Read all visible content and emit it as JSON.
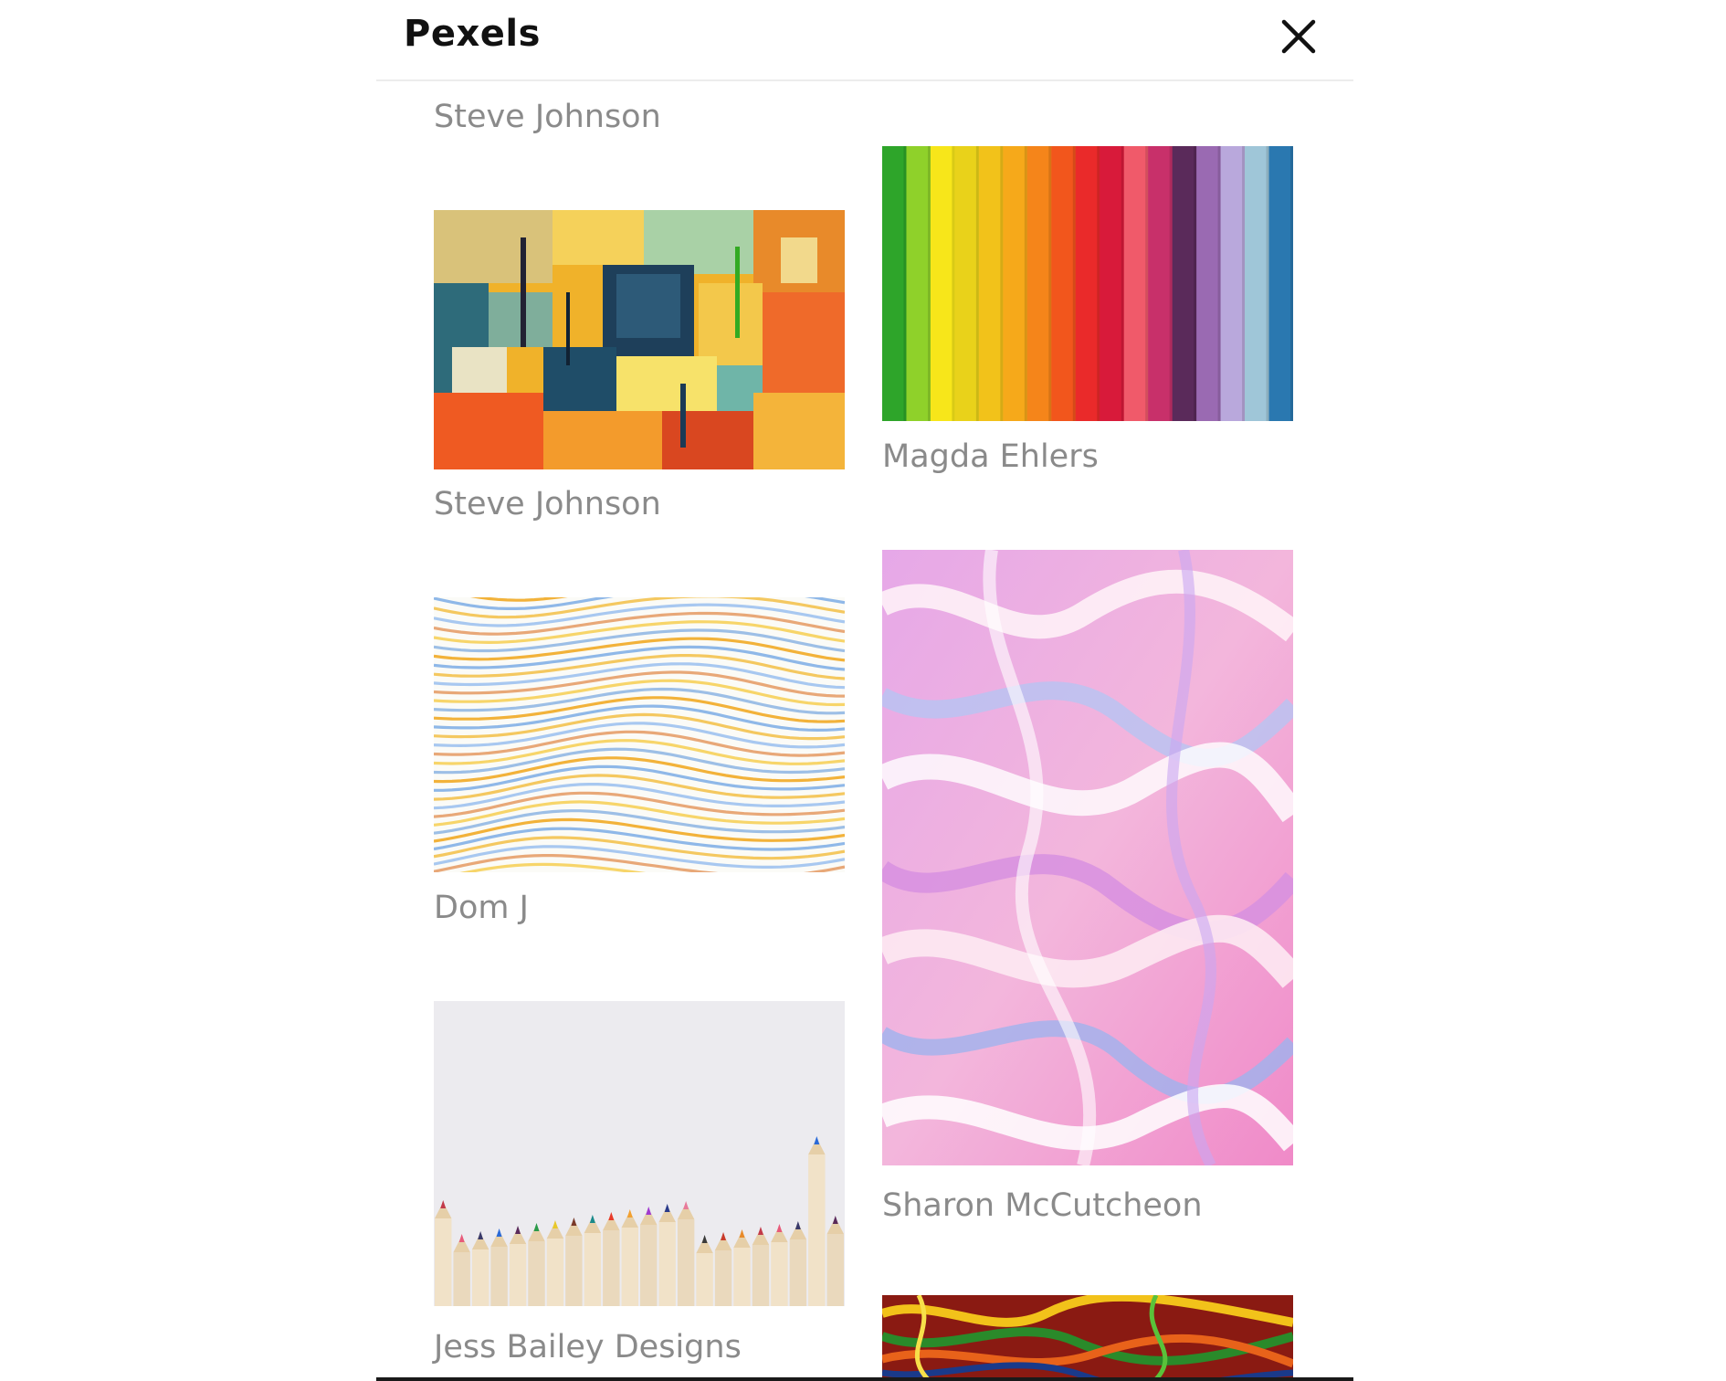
{
  "header": {
    "title": "Pexels",
    "close_icon": "close-icon"
  },
  "photos": [
    {
      "credit": "Steve Johnson",
      "image": "partially-scrolled-photo"
    },
    {
      "credit": "Steve Johnson",
      "image": "abstract-painting"
    },
    {
      "credit": "Magda Ehlers",
      "image": "rainbow-paper-strips"
    },
    {
      "credit": "Dom J",
      "image": "wavy-pastel-lines"
    },
    {
      "credit": "Sharon McCutcheon",
      "image": "pink-paint-swirls"
    },
    {
      "credit": "Jess Bailey Designs",
      "image": "colored-pencils"
    },
    {
      "credit": "",
      "image": "marbled-paint"
    }
  ]
}
